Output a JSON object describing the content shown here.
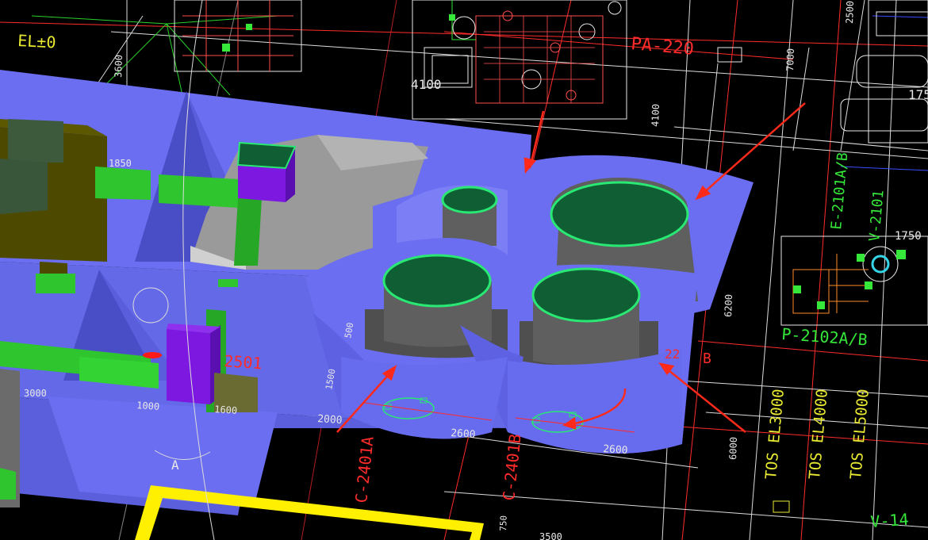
{
  "colors": {
    "background": "#000000",
    "blue_solid": "#6b6ef0",
    "blue_dark": "#4f52c8",
    "gray_vessel": "#5f5f5f",
    "gray_vessel_light": "#8a8a8a",
    "green_top": "#0f5e34",
    "green_rim": "#29e873",
    "green_bright": "#22c52e",
    "purple_box": "#7c18e0",
    "olive": "#4d4a00",
    "yellow_frame": "#ffef00",
    "red_arrow": "#ff2a1a",
    "cad_white": "#e8e8e8",
    "cad_red": "#ff2b2b",
    "cad_yellow": "#e8e832",
    "cad_green": "#35e83a"
  },
  "labels": {
    "el_zero": "EL±0",
    "pa_220": "PA-220",
    "dim_4100": "4100",
    "dim_3600": "3600",
    "dim_7000": "7000",
    "dim_4100_v": "4100",
    "dim_2500_top": "2500",
    "dim_175": "175",
    "dim_1750": "1750",
    "dim_6200": "6200",
    "e_2101": "E-2101A/B",
    "v_2101": "V-2101",
    "p_2102": "P-2102A/B",
    "tag_2501": "2501",
    "dim_3000": "3000",
    "dim_1000": "1000",
    "dim_1600": "1600",
    "dim_1500": "1500",
    "dim_500": "500",
    "dim_2000": "2000",
    "dim_2600_a": "2600",
    "dim_2600_b": "2600",
    "c_2401a": "C-2401A",
    "c_2401b": "C-2401B",
    "tos_3000": "TOS EL3000",
    "tos_4000": "TOS EL4000",
    "tos_5000": "TOS EL5000",
    "dim_6000": "6000",
    "dim_750": "750",
    "dim_3500": "3500",
    "v_14": "V-14",
    "section_a": "A",
    "dim_1850": "1850",
    "pipe_b": "B",
    "dim_22": "22"
  }
}
